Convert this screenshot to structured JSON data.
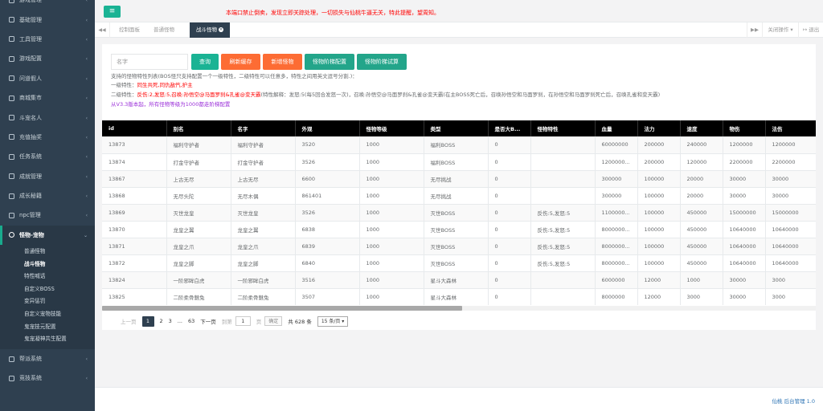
{
  "sidebar": {
    "items_top": [
      {
        "label": "游戏管理",
        "icon": "gamepad-icon"
      },
      {
        "label": "基础管理",
        "icon": "cutlery-icon"
      },
      {
        "label": "工具管理",
        "icon": "wrench-icon"
      },
      {
        "label": "游戏配置",
        "icon": "grid-icon"
      },
      {
        "label": "问道假人",
        "icon": "user-icon"
      },
      {
        "label": "商城集市",
        "icon": "gear-icon"
      },
      {
        "label": "斗宠名人",
        "icon": "star-icon"
      },
      {
        "label": "充值抽奖",
        "icon": "gift-icon"
      },
      {
        "label": "任务系统",
        "icon": "gear-icon"
      },
      {
        "label": "成就管理",
        "icon": "trophy-icon"
      },
      {
        "label": "成长秘籍",
        "icon": "book-icon"
      },
      {
        "label": "npc管理",
        "icon": "square-icon"
      }
    ],
    "active": {
      "label": "怪物-宠物",
      "icon": "pie-chart-icon"
    },
    "sub_items": [
      "普通怪物",
      "战斗怪物",
      "特性喊话",
      "自定义BOSS",
      "变异惩罚",
      "自定义宠物技能",
      "鬼宠技元配置",
      "鬼宠凝神共生配置"
    ],
    "active_sub_index": 1,
    "items_bottom": [
      {
        "label": "帮派系统",
        "icon": "grid-icon"
      },
      {
        "label": "竞技系统",
        "icon": "share-icon"
      }
    ]
  },
  "topbar": {
    "menu_icon": "≡",
    "notice": "本端口禁止倒卖，发现立即关踪处理，一切损失与仙桃牛逼无关，特此提醒，望周知。"
  },
  "tabs": {
    "back_icon": "◀◀",
    "items": [
      "控制面板",
      "普通怪物",
      "战斗怪物"
    ],
    "active_index": 2,
    "forward_icon": "▶▶",
    "close_ops": "关闭操作 ▾",
    "logout": "退出"
  },
  "toolbar": {
    "search_placeholder": "名字",
    "buttons": [
      "查询",
      "刷新缓存",
      "新增怪物",
      "怪物阶梯配置",
      "怪物阶梯试算"
    ]
  },
  "info": {
    "line1": "支持的怪物特性列表(BOS怪只支持配置一个一级特性，二级特性可以任意多，特性之间用英文逗号分割.)：",
    "line2_label": "一级特性：",
    "line2_value": "同生共死,同仇敌忾,护主",
    "line3_label": "二级特性：",
    "line3_value": "反伤:2,发怒:5,召唤:孙悟空@马面罗刹&孔雀@变天霸",
    "line3_rest": "(特性解释：发怒:5(每5回合发怒一次)，召唤:孙悟空@马面罗刹&孔雀@变天霸(在主BOSS死亡后，召唤孙悟空和马面罗刹，在孙悟空和马面罗刹死亡后，召唤孔雀和变天霸)",
    "line4": "从V3.3版本起，所有怪物等级为1000都走阶梯配置"
  },
  "table": {
    "columns": [
      "id",
      "别名",
      "名字",
      "外观",
      "怪物等级",
      "类型",
      "是否大B...",
      "怪物特性",
      "血量",
      "法力",
      "速度",
      "物伤",
      "法伤"
    ],
    "rows": [
      [
        "13873",
        "福利守护者",
        "福利守护者",
        "3520",
        "1000",
        "福利BOSS",
        "0",
        "",
        "60000000",
        "200000",
        "240000",
        "1200000",
        "1200000"
      ],
      [
        "13874",
        "打金守护者",
        "打金守护者",
        "3526",
        "1000",
        "福利BOSS",
        "0",
        "",
        "1200000...",
        "200000",
        "120000",
        "2200000",
        "2200000"
      ],
      [
        "13867",
        "上古无尽",
        "上古无尽",
        "6600",
        "1000",
        "无尽挑战",
        "0",
        "",
        "300000",
        "100000",
        "20000",
        "30000",
        "30000"
      ],
      [
        "13868",
        "无尽头陀",
        "无尽木偶",
        "861401",
        "1000",
        "无尽挑战",
        "0",
        "",
        "300000",
        "100000",
        "20000",
        "30000",
        "30000"
      ],
      [
        "13869",
        "灭世龙皇",
        "灭世龙皇",
        "3526",
        "1000",
        "灭世BOSS",
        "0",
        "反伤:5,发怒:5",
        "1100000...",
        "100000",
        "450000",
        "15000000",
        "15000000"
      ],
      [
        "13870",
        "龙皇之翼",
        "龙皇之翼",
        "6838",
        "1000",
        "灭世BOSS",
        "0",
        "反伤:5,发怒:5",
        "8000000...",
        "100000",
        "450000",
        "10640000",
        "10640000"
      ],
      [
        "13871",
        "龙皇之爪",
        "龙皇之爪",
        "6839",
        "1000",
        "灭世BOSS",
        "0",
        "反伤:5,发怒:5",
        "8000000...",
        "100000",
        "450000",
        "10640000",
        "10640000"
      ],
      [
        "13872",
        "龙皇之脚",
        "龙皇之脚",
        "6840",
        "1000",
        "灭世BOSS",
        "0",
        "反伤:5,发怒:5",
        "8000000...",
        "100000",
        "450000",
        "10640000",
        "10640000"
      ],
      [
        "13824",
        "一阶邪眸白虎",
        "一阶邪眸白虎",
        "3516",
        "1000",
        "星斗大森林",
        "0",
        "",
        "6000000",
        "12000",
        "1000",
        "30000",
        "3000"
      ],
      [
        "13825",
        "二阶柔骨魅兔",
        "二阶柔骨魅兔",
        "3507",
        "1000",
        "星斗大森林",
        "0",
        "",
        "8000000",
        "12000",
        "3000",
        "30000",
        "3000"
      ]
    ]
  },
  "pager": {
    "prev": "上一页",
    "pages": [
      "1",
      "2",
      "3",
      "...",
      "63"
    ],
    "current_index": 0,
    "next": "下一页",
    "goto_label": "到第",
    "goto_value": "1",
    "page_unit": "页",
    "confirm": "确定",
    "total": "共 628 条",
    "page_size": "15 条/页 ▾"
  },
  "footer": {
    "text": "仙桃 后台管理 1.0"
  }
}
